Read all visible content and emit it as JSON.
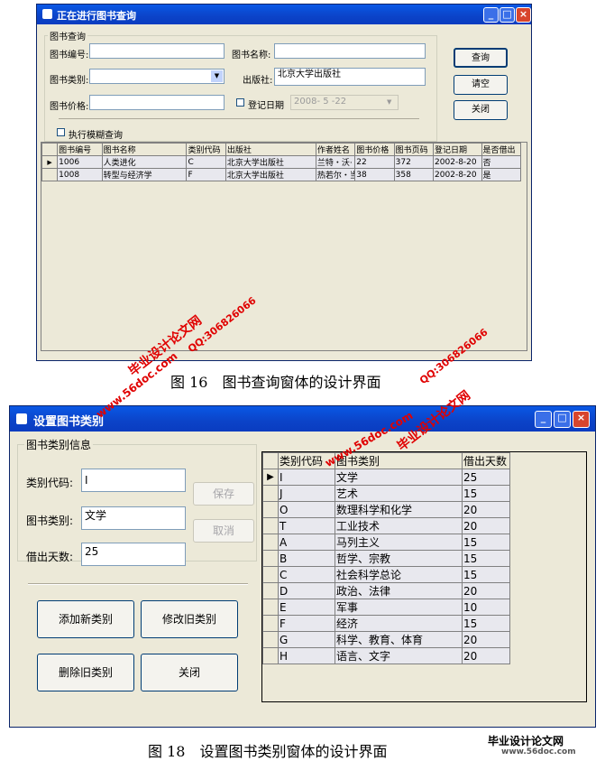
{
  "win1": {
    "title": "正在进行图书查询",
    "group_title": "图书查询",
    "labels": {
      "book_no": "图书编号:",
      "book_name": "图书名称:",
      "category": "图书类别:",
      "publisher": "出版社:",
      "price": "图书价格:",
      "reg_date": "登记日期",
      "fuzzy": "执行模糊查询"
    },
    "publisher_value": "北京大学出版社",
    "date_value": "2008- 5 -22",
    "buttons": {
      "query": "查询",
      "clear": "请空",
      "close": "关闭"
    },
    "grid": {
      "headers": [
        "图书编号",
        "图书名称",
        "类别代码",
        "出版社",
        "作者姓名",
        "图书价格",
        "图书页码",
        "登记日期",
        "是否借出"
      ],
      "rows": [
        [
          "1006",
          "人类进化",
          "C",
          "北京大学出版社",
          "兰特・沃·",
          "22",
          "372",
          "2002-8-20",
          "否"
        ],
        [
          "1008",
          "转型与经济学",
          "F",
          "北京大学出版社",
          "热若尔・当",
          "38",
          "358",
          "2002-8-20",
          "是"
        ]
      ]
    }
  },
  "caption1": "图 16　图书查询窗体的设计界面",
  "win2": {
    "title": "设置图书类别",
    "group_title": "图书类别信息",
    "labels": {
      "code": "类别代码:",
      "category": "图书类别:",
      "days": "借出天数:"
    },
    "values": {
      "code": "I",
      "category": "文学",
      "days": "25"
    },
    "buttons": {
      "save": "保存",
      "cancel": "取消",
      "add": "添加新类别",
      "modify": "修改旧类别",
      "delete": "删除旧类别",
      "close": "关闭"
    },
    "grid": {
      "headers": [
        "类别代码",
        "图书类别",
        "借出天数"
      ],
      "rows": [
        [
          "I",
          "文学",
          "25"
        ],
        [
          "J",
          "艺术",
          "15"
        ],
        [
          "O",
          "数理科学和化学",
          "20"
        ],
        [
          "T",
          "工业技术",
          "20"
        ],
        [
          "A",
          "马列主义",
          "15"
        ],
        [
          "B",
          "哲学、宗教",
          "15"
        ],
        [
          "C",
          "社会科学总论",
          "15"
        ],
        [
          "D",
          "政治、法律",
          "20"
        ],
        [
          "E",
          "军事",
          "10"
        ],
        [
          "F",
          "经济",
          "15"
        ],
        [
          "G",
          "科学、教育、体育",
          "20"
        ],
        [
          "H",
          "语言、文字",
          "20"
        ]
      ]
    }
  },
  "caption2": "图 18　设置图书类别窗体的设计界面",
  "watermarks": {
    "site_cn": "毕业设计论文网",
    "qq": "QQ:306826066",
    "url": "www.56doc.com"
  }
}
